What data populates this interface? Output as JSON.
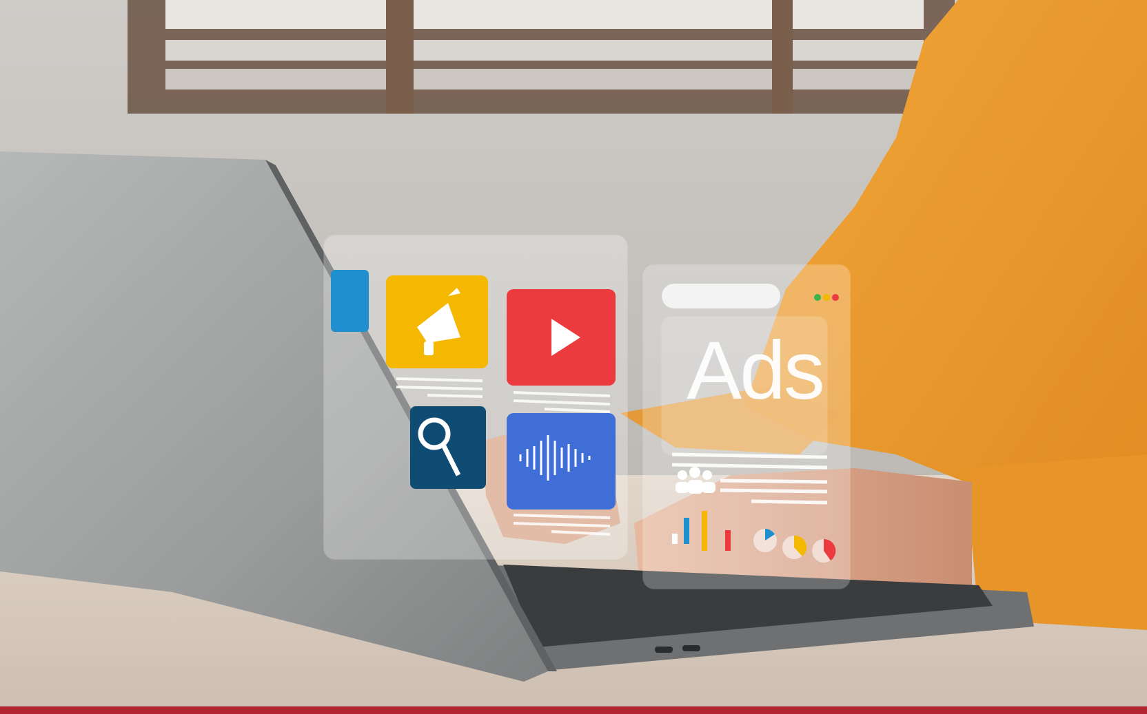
{
  "overlay": {
    "ads_label": "Ads",
    "tiles": [
      {
        "name": "megaphone-tile",
        "icon": "megaphone-icon",
        "color": "#f5b800"
      },
      {
        "name": "video-play-tile",
        "icon": "play-icon",
        "color": "#ec3b3f"
      },
      {
        "name": "search-tile",
        "icon": "magnifier-icon",
        "color": "#0e4c73"
      },
      {
        "name": "audio-wave-tile",
        "icon": "sound-wave-icon",
        "color": "#3f6fd6"
      },
      {
        "name": "partial-blue-tile",
        "icon": "",
        "color": "#1f8fd0"
      }
    ],
    "window_dots": [
      "#3bb54a",
      "#f5b800",
      "#ec3b3f"
    ]
  },
  "colors": {
    "sweater": "#ec9a2c",
    "laptop": "#9a9c9c",
    "desk": "#d8ccbf",
    "bottom_bar": "#b32631"
  }
}
